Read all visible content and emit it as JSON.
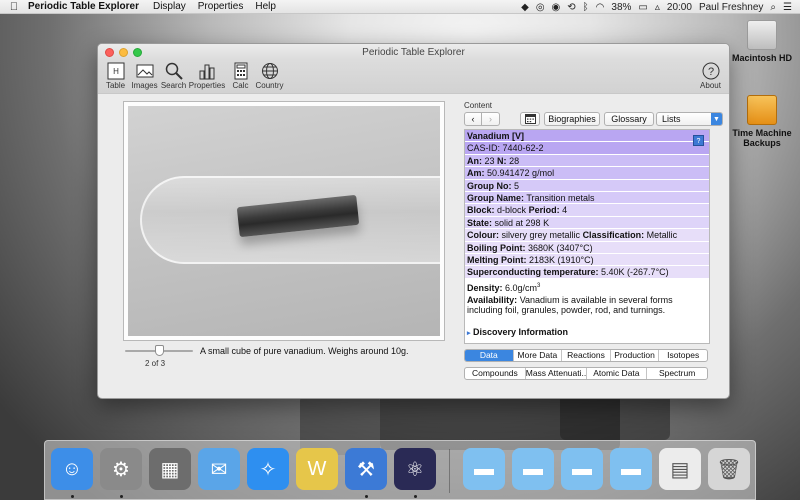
{
  "menubar": {
    "app_name": "Periodic Table Explorer",
    "menus": [
      "Display",
      "Properties",
      "Help"
    ],
    "battery": "38%",
    "time": "20:00",
    "user": "Paul Freshney"
  },
  "desktop_icons": [
    {
      "label": "Macintosh HD",
      "color": "#d8d8d8"
    },
    {
      "label": "Time Machine Backups",
      "color": "#f2a52a"
    }
  ],
  "window": {
    "title": "Periodic Table Explorer",
    "toolbar": [
      {
        "label": "Table",
        "icon": "table-icon"
      },
      {
        "label": "Images",
        "icon": "images-icon"
      },
      {
        "label": "Search",
        "icon": "search-icon"
      },
      {
        "label": "Properties",
        "icon": "properties-icon"
      },
      {
        "label": "Calc",
        "icon": "calc-icon"
      },
      {
        "label": "Country",
        "icon": "globe-icon"
      }
    ],
    "about_label": "About"
  },
  "image_viewer": {
    "caption": "A small cube of pure vanadium. Weighs around 10g.",
    "count": "2 of 3",
    "slider_fraction": 0.5
  },
  "content": {
    "label": "Content",
    "nav": {
      "back": "‹",
      "forward": "›",
      "biographies": "Biographies",
      "glossary": "Glossary",
      "lists": "Lists"
    },
    "element": {
      "name": "Vanadium [V]",
      "cas_id": "CAS-ID: 7440-62-2",
      "an_label": "An:",
      "an_value": "23",
      "n_label": "N:",
      "n_value": "28",
      "am_label": "Am:",
      "am_value": "50.941472 g/mol",
      "group_no_label": "Group No:",
      "group_no_value": "5",
      "group_name_label": "Group Name:",
      "group_name_value": "Transition metals",
      "block_label": "Block:",
      "block_value": "d-block",
      "period_label": "Period:",
      "period_value": "4",
      "state_label": "State:",
      "state_value": "solid at 298 K",
      "colour_label": "Colour:",
      "colour_value": "silvery grey metallic",
      "classification_label": "Classification:",
      "classification_value": "Metallic",
      "boiling_label": "Boiling Point:",
      "boiling_value": "3680K (3407°C)",
      "melting_label": "Melting Point:",
      "melting_value": "2183K (1910°C)",
      "superconducting_label": "Superconducting temperature:",
      "superconducting_value": "5.40K (-267.7°C)",
      "density_label": "Density:",
      "density_value": "6.0g/cm",
      "density_exp": "3",
      "availability_label": "Availability:",
      "availability_value": "Vanadium is available in several forms including foil, granules, powder, rod, and turnings.",
      "discovery": "Discovery Information",
      "help": "?"
    },
    "tabs_row1": [
      "Data",
      "More Data",
      "Reactions",
      "Production",
      "Isotopes"
    ],
    "tabs_row2": [
      "Compounds",
      "Mass Attenuati...",
      "Atomic Data",
      "Spectrum"
    ],
    "active_tab": "Data"
  },
  "dock": [
    {
      "name": "finder",
      "color": "#3d8ee8",
      "dot": true
    },
    {
      "name": "system-preferences",
      "color": "#8a8a8a",
      "dot": true
    },
    {
      "name": "calculator",
      "color": "#6d6d6d",
      "dot": false
    },
    {
      "name": "mail",
      "color": "#5aa5e8",
      "dot": false
    },
    {
      "name": "safari",
      "color": "#2e8ff0",
      "dot": false
    },
    {
      "name": "app",
      "color": "#e6c64a",
      "dot": false
    },
    {
      "name": "xcode",
      "color": "#3c7ad6",
      "dot": true
    },
    {
      "name": "periodic-table-explorer",
      "color": "#2a2a55",
      "dot": true
    },
    {
      "name": "folder",
      "color": "#7fc0f0",
      "dot": false
    },
    {
      "name": "folder",
      "color": "#7fc0f0",
      "dot": false
    },
    {
      "name": "folder",
      "color": "#7fc0f0",
      "dot": false
    },
    {
      "name": "folder",
      "color": "#7fc0f0",
      "dot": false
    },
    {
      "name": "preview",
      "color": "#ececec",
      "dot": false
    },
    {
      "name": "trash",
      "color": "#d6d6d6",
      "dot": false
    }
  ]
}
